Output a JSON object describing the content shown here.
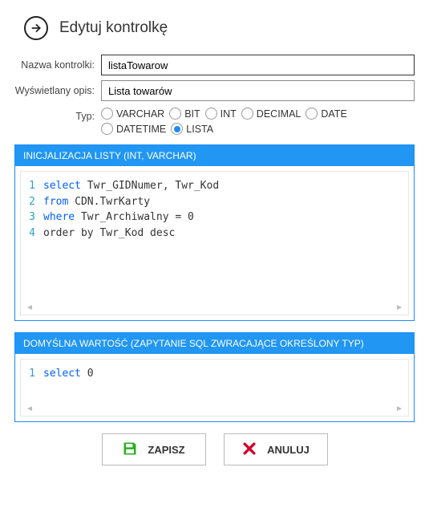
{
  "title": "Edytuj kontrolkę",
  "form": {
    "name_label": "Nazwa kontrolki:",
    "name_value": "listaTowarow",
    "desc_label": "Wyświetlany opis:",
    "desc_value": "Lista towarów",
    "type_label": "Typ:",
    "types": [
      {
        "label": "VARCHAR",
        "selected": false
      },
      {
        "label": "BIT",
        "selected": false
      },
      {
        "label": "INT",
        "selected": false
      },
      {
        "label": "DECIMAL",
        "selected": false
      },
      {
        "label": "DATE",
        "selected": false
      },
      {
        "label": "DATETIME",
        "selected": false
      },
      {
        "label": "LISTA",
        "selected": true
      }
    ]
  },
  "init_section": {
    "header": "INICJALIZACJA LISTY (INT, VARCHAR)",
    "lines": [
      {
        "n": "1",
        "tokens": [
          [
            "kw",
            "select"
          ],
          [
            "txt",
            " Twr_GIDNumer, Twr_Kod"
          ]
        ]
      },
      {
        "n": "2",
        "tokens": [
          [
            "kw",
            "from"
          ],
          [
            "txt",
            " CDN.TwrKarty"
          ]
        ]
      },
      {
        "n": "3",
        "tokens": [
          [
            "kw",
            "where"
          ],
          [
            "txt",
            " Twr_Archiwalny = 0"
          ]
        ]
      },
      {
        "n": "4",
        "tokens": [
          [
            "txt",
            "order by Twr_Kod desc"
          ]
        ]
      }
    ]
  },
  "default_section": {
    "header": "DOMYŚLNA WARTOŚĆ (ZAPYTANIE SQL ZWRACAJĄCE OKREŚLONY TYP)",
    "lines": [
      {
        "n": "1",
        "tokens": [
          [
            "kw",
            "select"
          ],
          [
            "txt",
            " 0"
          ]
        ]
      }
    ]
  },
  "buttons": {
    "save": "ZAPISZ",
    "cancel": "ANULUJ"
  }
}
